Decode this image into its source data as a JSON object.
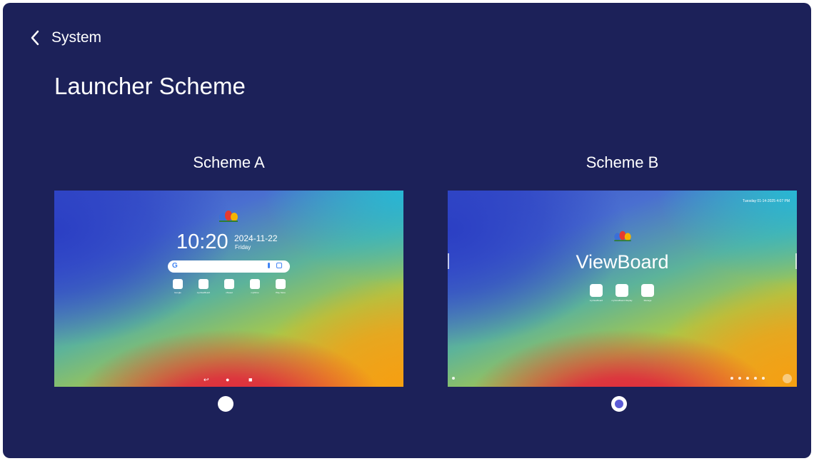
{
  "header": {
    "back_label": "System"
  },
  "page": {
    "title": "Launcher Scheme"
  },
  "schemes": [
    {
      "label": "Scheme A",
      "selected": false,
      "preview": {
        "time": "10:20",
        "date": "2024-11-22",
        "day": "Friday",
        "apps": [
          "Google",
          "myViewBoard",
          "vSweet",
          "myDrive",
          "Play Store"
        ]
      }
    },
    {
      "label": "Scheme B",
      "selected": true,
      "preview": {
        "datetime": "Tuesday 01-14-2025   4:07 PM",
        "title": "ViewBoard",
        "apps": [
          "myViewBoard",
          "myViewBoard Display",
          "Manage"
        ]
      }
    }
  ],
  "colors": {
    "background": "#1c2159",
    "radio_fill": "#ffffff",
    "radio_selected_dot": "#5b5bd6"
  },
  "icons": {
    "back": "chevron-left-icon",
    "logo": "viewsonic-birds-logo-icon"
  }
}
